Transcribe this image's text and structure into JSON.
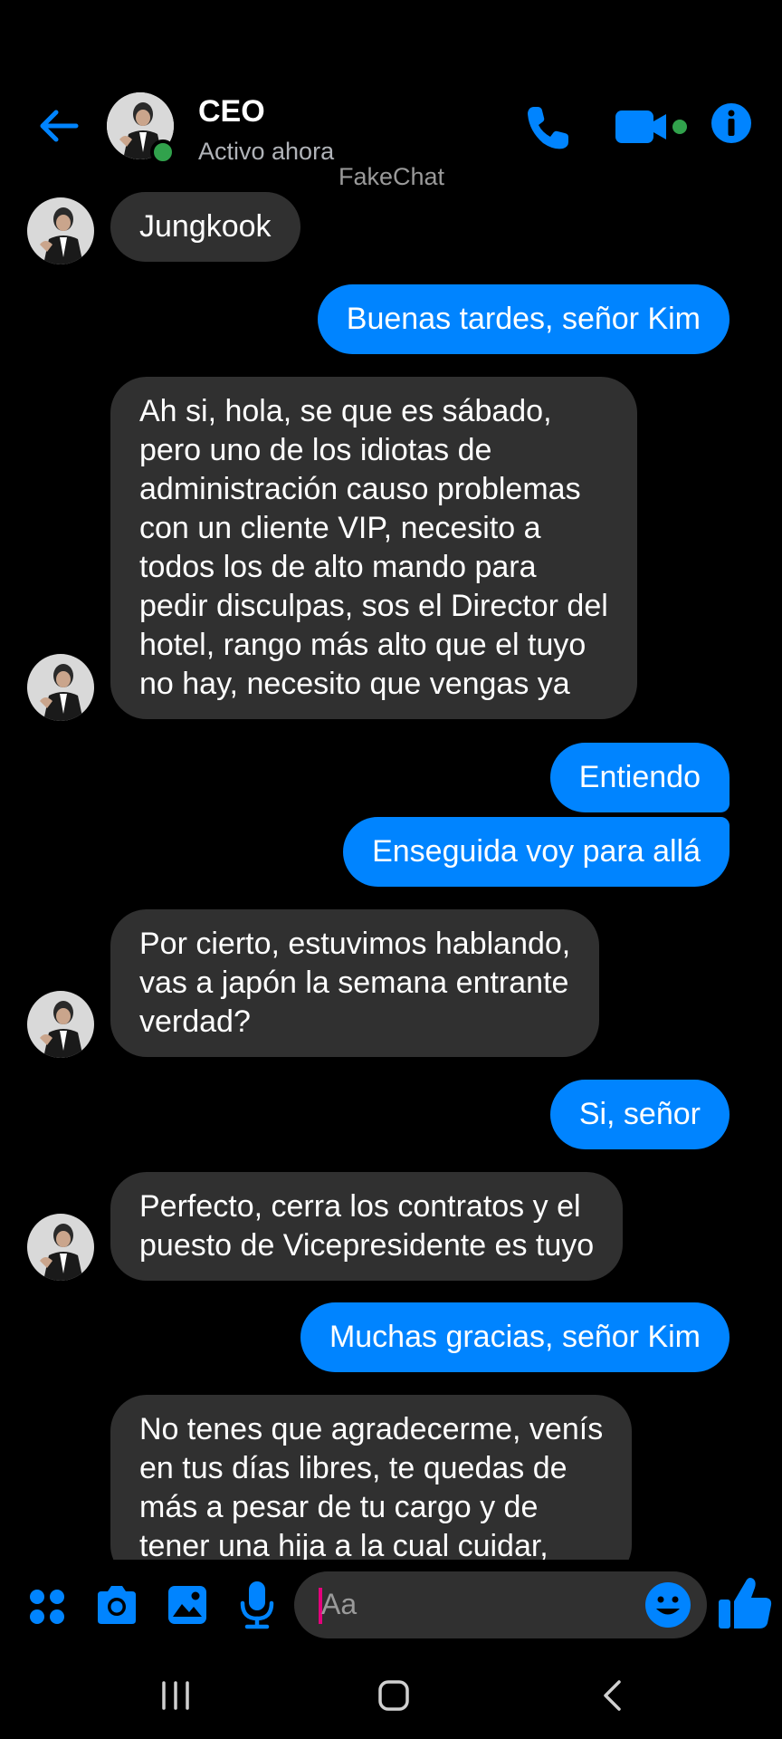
{
  "header": {
    "contact_name": "CEO",
    "status": "Activo ahora",
    "watermark": "FakeChat"
  },
  "messages": [
    {
      "from": "them",
      "text": "Jungkook"
    },
    {
      "from": "me",
      "text": "Buenas tardes, señor Kim"
    },
    {
      "from": "them",
      "text": "Ah si, hola, se que es sábado,\npero uno de los idiotas de\nadministración causo problemas\ncon un cliente VIP, necesito a\ntodos los de alto mando para\npedir disculpas, sos el Director del\nhotel, rango más alto que el tuyo\nno hay, necesito que vengas ya"
    },
    {
      "from": "me",
      "text": "Entiendo"
    },
    {
      "from": "me",
      "text": "Enseguida voy para allá"
    },
    {
      "from": "them",
      "text": "Por cierto, estuvimos hablando,\nvas a japón la semana entrante\nverdad?"
    },
    {
      "from": "me",
      "text": "Si, señor"
    },
    {
      "from": "them",
      "text": "Perfecto, cerra los contratos y el\npuesto de Vicepresidente es tuyo"
    },
    {
      "from": "me",
      "text": "Muchas gracias, señor Kim"
    },
    {
      "from": "them",
      "text": "No tenes que agradecerme, venís\nen tus días libres, te quedas de\nmás a pesar de tu cargo y de\ntener una hija a la cual cuidar,"
    }
  ],
  "composer": {
    "placeholder": "Aa",
    "icons": [
      "apps-icon",
      "camera-icon",
      "gallery-icon",
      "microphone-icon",
      "emoji-icon",
      "thumbs-up-icon"
    ]
  },
  "colors": {
    "accent": "#0084ff",
    "received_bubble": "#303030",
    "background": "#000000",
    "online": "#31a24c"
  },
  "navbar": {
    "icons": [
      "recent-apps-icon",
      "home-icon",
      "back-nav-icon"
    ]
  }
}
